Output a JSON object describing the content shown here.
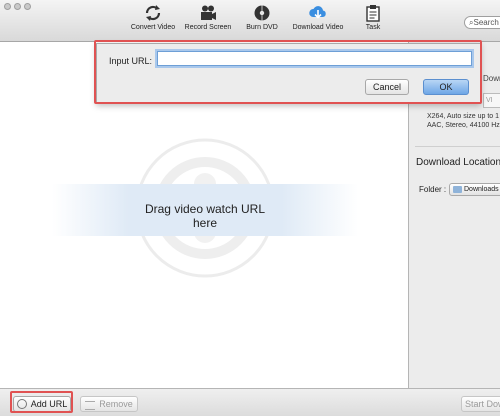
{
  "toolbar": {
    "items": [
      {
        "label": "Convert Video",
        "icon": "refresh-icon"
      },
      {
        "label": "Record Screen",
        "icon": "camera-icon"
      },
      {
        "label": "Burn DVD",
        "icon": "disc-icon"
      },
      {
        "label": "Download Video",
        "icon": "cloud-download-icon"
      },
      {
        "label": "Task",
        "icon": "clipboard-icon"
      }
    ],
    "search_text": "Search"
  },
  "main": {
    "drop_text": "Drag video watch URL\nhere"
  },
  "side": {
    "format_name": "Downlo",
    "format_field": "VI",
    "format_desc": "X264, Auto size up to 1\nAAC, Stereo, 44100 Hz",
    "location_title": "Download Location",
    "folder_label": "Folder :",
    "folder_value": "Downloads"
  },
  "bottom": {
    "add_url": "Add URL",
    "remove": "Remove",
    "start_download": "Start Dow"
  },
  "dialog": {
    "label": "Input URL:",
    "input_value": "",
    "cancel": "Cancel",
    "ok": "OK"
  },
  "colors": {
    "highlight": "#e05252",
    "accent": "#6ea6e6"
  }
}
